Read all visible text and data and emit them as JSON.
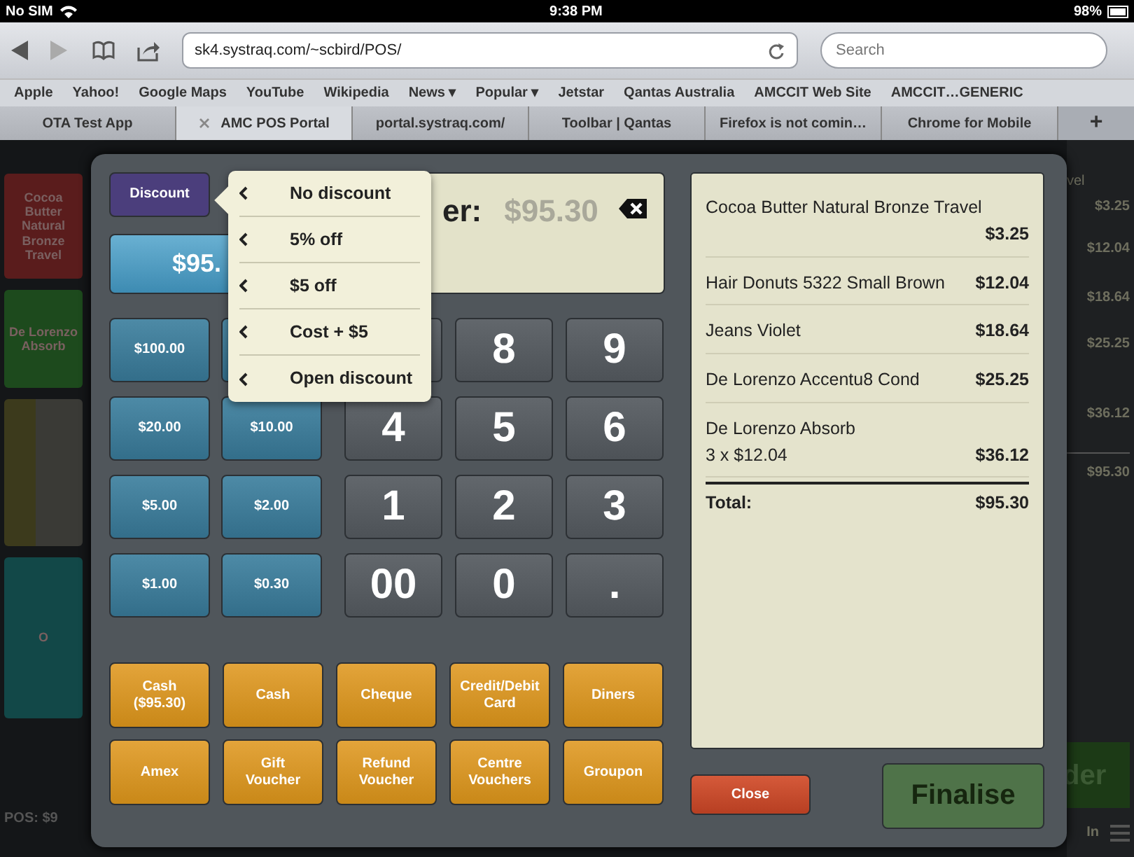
{
  "status_bar": {
    "carrier": "No SIM",
    "time": "9:38 PM",
    "battery": "98%"
  },
  "browser": {
    "url": "sk4.systraq.com/~scbird/POS/",
    "search_placeholder": "Search",
    "bookmarks": [
      {
        "label": "Apple"
      },
      {
        "label": "Yahoo!"
      },
      {
        "label": "Google Maps"
      },
      {
        "label": "YouTube"
      },
      {
        "label": "Wikipedia"
      },
      {
        "label": "News ▾"
      },
      {
        "label": "Popular ▾"
      },
      {
        "label": "Jetstar"
      },
      {
        "label": "Qantas Australia"
      },
      {
        "label": "AMCCIT Web Site"
      },
      {
        "label": "AMCCIT…GENERIC"
      }
    ],
    "tabs": [
      {
        "label": "OTA Test App",
        "selected": false
      },
      {
        "label": "AMC POS Portal",
        "selected": true
      },
      {
        "label": "portal.systraq.com/",
        "selected": false
      },
      {
        "label": "Toolbar | Qantas",
        "selected": false
      },
      {
        "label": "Firefox is not comin…",
        "selected": false
      },
      {
        "label": "Chrome for Mobile",
        "selected": false
      }
    ],
    "new_tab": "+"
  },
  "background": {
    "left_tiles": [
      {
        "kind": "text",
        "label": "Cocoa Butter Natural Bronze Travel",
        "color": "#5a1c1c"
      },
      {
        "kind": "text",
        "label": "De Lorenzo Absorb",
        "color": "#1d4a1d"
      },
      {
        "kind": "photo"
      },
      {
        "kind": "text",
        "label": "O",
        "color": "#124848"
      }
    ],
    "pos_label": "POS: $9",
    "right_title": "vel",
    "right_prices": [
      "$3.25",
      "$12.04",
      "$18.64",
      "$25.25",
      "$36.12"
    ],
    "right_total": "$95.30",
    "right_button": "der",
    "right_footer": "In"
  },
  "modal": {
    "discount_button": "Discount",
    "amount_button": "$95.",
    "display": {
      "label": "er:",
      "value": "$95.30"
    },
    "quick_cash": [
      {
        "label": "$100.00"
      },
      {
        "label": "$20.00"
      },
      {
        "label": "$10.00"
      },
      {
        "label": "$5.00"
      },
      {
        "label": "$2.00"
      },
      {
        "label": "$1.00"
      },
      {
        "label": "$0.30"
      }
    ],
    "keypad": [
      {
        "label": "8"
      },
      {
        "label": "9"
      },
      {
        "label": "4"
      },
      {
        "label": "5"
      },
      {
        "label": "6"
      },
      {
        "label": "1"
      },
      {
        "label": "2"
      },
      {
        "label": "3"
      },
      {
        "label": "00"
      },
      {
        "label": "0"
      },
      {
        "label": "."
      }
    ],
    "payments": [
      "Cash ($95.30)",
      "Cash",
      "Cheque",
      "Credit/Debit Card",
      "Diners",
      "Amex",
      "Gift Voucher",
      "Refund Voucher",
      "Centre Vouchers",
      "Groupon"
    ],
    "receipt": {
      "items": [
        {
          "name": "Cocoa Butter Natural Bronze Travel",
          "price": "$3.25"
        },
        {
          "name": "Hair Donuts 5322 Small Brown",
          "price": "$12.04"
        },
        {
          "name": "Jeans Violet",
          "price": "$18.64"
        },
        {
          "name": "De Lorenzo Accentu8 Cond",
          "price": "$25.25"
        },
        {
          "name": "De Lorenzo Absorb",
          "detail": "3 x $12.04",
          "price": "$36.12"
        }
      ],
      "total_label": "Total:",
      "total": "$95.30"
    },
    "close_button": "Close",
    "finalise_button": {
      "label": "Finalise",
      "disabled": true
    }
  },
  "discount_menu": {
    "items": [
      {
        "label": "No discount"
      },
      {
        "label": "5% off"
      },
      {
        "label": "$5 off"
      },
      {
        "label": "Cost + $5"
      },
      {
        "label": "Open discount"
      }
    ]
  }
}
